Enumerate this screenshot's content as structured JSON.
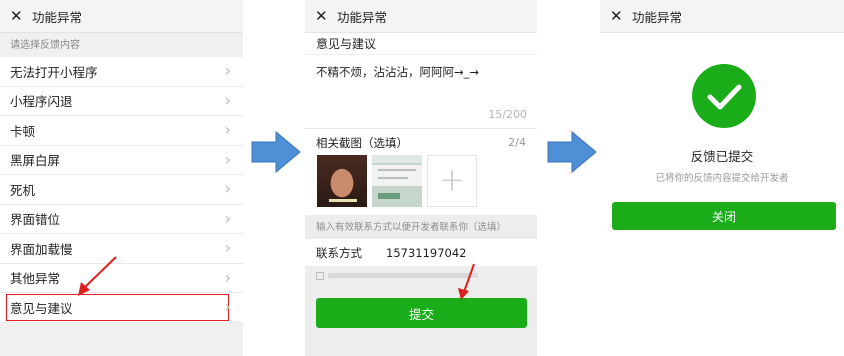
{
  "screen1": {
    "title": "功能异常",
    "close_icon": "close-icon",
    "section_hint": "请选择反馈内容",
    "items": [
      {
        "label": "无法打开小程序"
      },
      {
        "label": "小程序闪退"
      },
      {
        "label": "卡顿"
      },
      {
        "label": "黑屏白屏"
      },
      {
        "label": "死机"
      },
      {
        "label": "界面错位"
      },
      {
        "label": "界面加载慢"
      },
      {
        "label": "其他异常"
      },
      {
        "label": "意见与建议"
      }
    ]
  },
  "screen2": {
    "title": "功能异常",
    "category": "意见与建议",
    "body_text": "不精不烦，沾沾沾，阿阿阿→_→",
    "char_count": "15/200",
    "screenshots_label": "相关截图（选填）",
    "screenshots_count": "2/4",
    "contact_hint": "输入有效联系方式以便开发者联系你（选填）",
    "contact_label": "联系方式",
    "contact_value": "15731197042",
    "submit_label": "提交"
  },
  "screen3": {
    "title": "功能异常",
    "heading": "反馈已提交",
    "description": "已将你的反馈内容提交给开发者",
    "close_label": "关闭"
  },
  "colors": {
    "primary_green": "#1aad19",
    "flow_arrow_blue": "#4f8fd6",
    "annotation_red": "#e02020"
  }
}
